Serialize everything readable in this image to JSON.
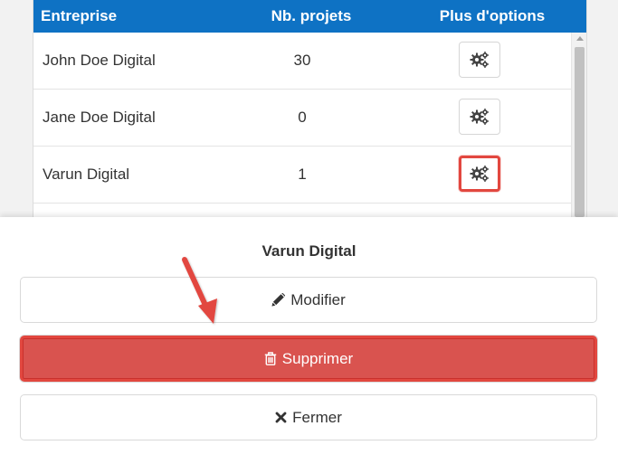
{
  "table": {
    "headers": {
      "company": "Entreprise",
      "projects": "Nb. projets",
      "options": "Plus d'options"
    },
    "rows": [
      {
        "company": "John Doe Digital",
        "projects": "30",
        "options_icon": "gears-icon"
      },
      {
        "company": "Jane Doe Digital",
        "projects": "0",
        "options_icon": "gears-icon"
      },
      {
        "company": "Varun Digital",
        "projects": "1",
        "options_icon": "gears-icon",
        "highlighted": true
      }
    ],
    "header_color": "#0e72c4"
  },
  "action_sheet": {
    "title": "Varun Digital",
    "buttons": {
      "modify": {
        "label": "Modifier",
        "icon": "pencil-icon"
      },
      "delete": {
        "label": "Supprimer",
        "icon": "trash-icon",
        "color": "#d9534f"
      },
      "close": {
        "label": "Fermer",
        "icon": "close-icon"
      }
    }
  },
  "annotation": {
    "arrow_color": "#e2473f",
    "highlight_color": "#e2473f"
  }
}
